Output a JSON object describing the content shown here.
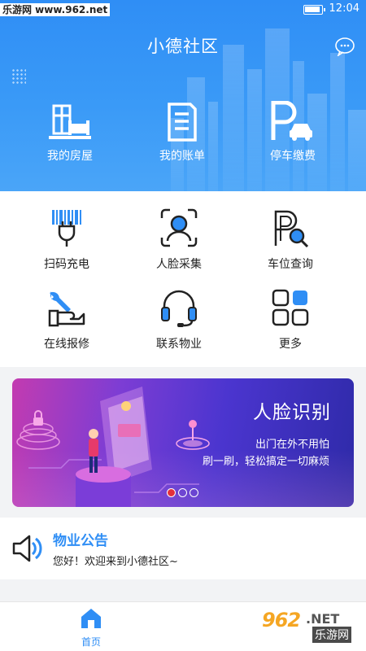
{
  "status": {
    "watermark": "乐游网 www.962.net",
    "time": "12:04"
  },
  "header": {
    "title": "小德社区"
  },
  "top_items": [
    {
      "label": "我的房屋",
      "icon": "house-icon"
    },
    {
      "label": "我的账单",
      "icon": "bill-icon"
    },
    {
      "label": "停车缴费",
      "icon": "parking-payment-icon"
    }
  ],
  "grid": [
    {
      "label": "扫码充电",
      "icon": "scan-charge-icon"
    },
    {
      "label": "人脸采集",
      "icon": "face-capture-icon"
    },
    {
      "label": "车位查询",
      "icon": "parking-search-icon"
    },
    {
      "label": "在线报修",
      "icon": "repair-icon"
    },
    {
      "label": "联系物业",
      "icon": "headset-icon"
    },
    {
      "label": "更多",
      "icon": "more-icon"
    }
  ],
  "banner": {
    "title": "人脸识别",
    "line1": "出门在外不用怕",
    "line2": "刷一刷，轻松搞定一切麻烦",
    "pages": 3,
    "active_page": 1
  },
  "notice": {
    "title": "物业公告",
    "text": "您好！欢迎来到小德社区~"
  },
  "tabbar": {
    "home_label": "首页"
  },
  "watermark_logo": {
    "num": "962",
    "net": ".NET",
    "cn": "乐游网"
  },
  "colors": {
    "primary": "#2f8ef5",
    "banner_start": "#c33bb0",
    "banner_end": "#2e2aa8",
    "pager_active": "#e3303c"
  }
}
